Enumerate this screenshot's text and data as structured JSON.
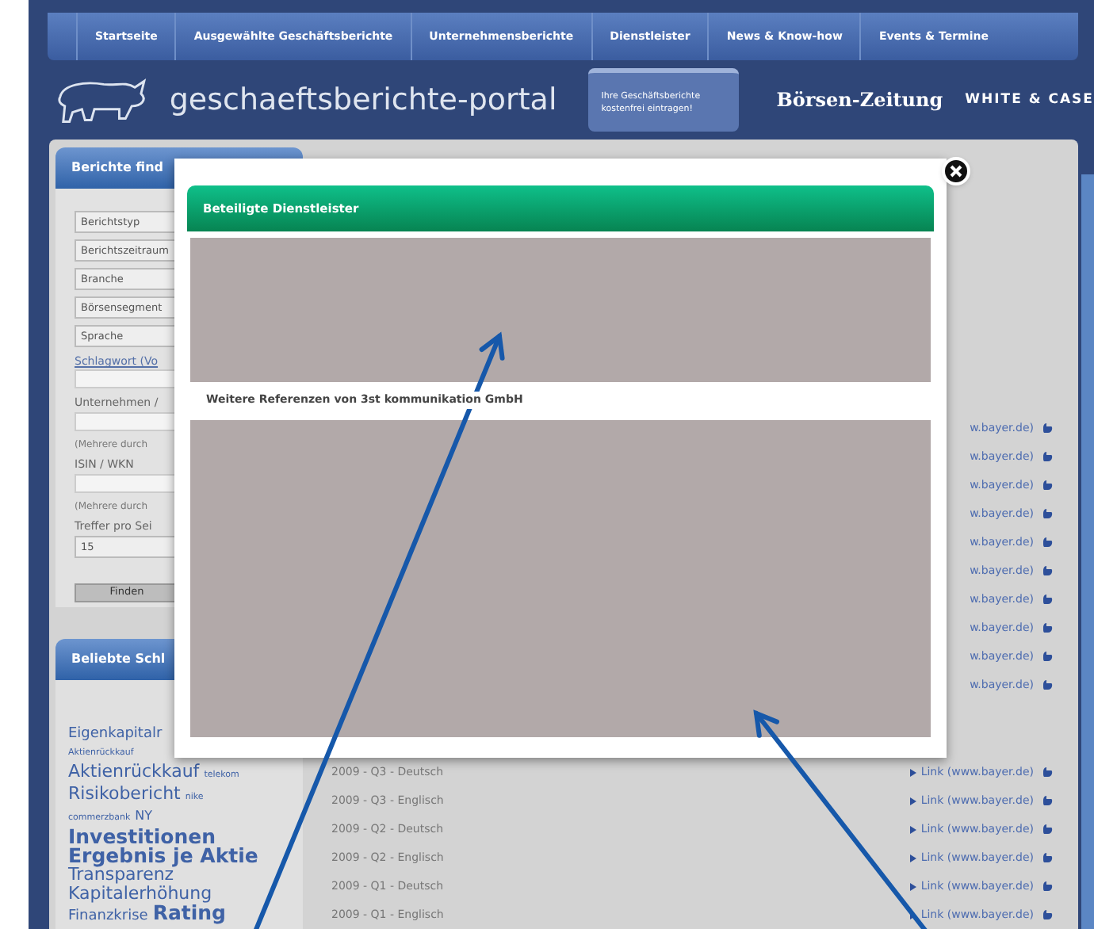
{
  "nav": {
    "tabs": [
      "Startseite",
      "Ausgewählte Geschäftsberichte",
      "Unternehmensberichte",
      "Dienstleister",
      "News & Know-how",
      "Events & Termine"
    ]
  },
  "header": {
    "logo_text": "geschaeftsberichte-portal",
    "cta_lines": [
      "Ihre Geschäftsberichte",
      "kostenfrei eintragen!"
    ],
    "partners": [
      {
        "kind": "newspaper",
        "text": "Börsen-Zeitung"
      },
      {
        "kind": "firm",
        "text": "WHITE & CASE"
      }
    ]
  },
  "search_panel": {
    "title": "Berichte find",
    "fields": [
      {
        "kind": "select",
        "text": "Berichtstyp"
      },
      {
        "kind": "select",
        "text": "Berichtszeitraum"
      },
      {
        "kind": "select",
        "text": "Branche"
      },
      {
        "kind": "select",
        "text": "Börsensegment"
      },
      {
        "kind": "select",
        "text": "Sprache"
      },
      {
        "kind": "link",
        "text": "Schlagwort (Vo"
      },
      {
        "kind": "input"
      },
      {
        "kind": "label",
        "text": "Unternehmen /"
      },
      {
        "kind": "input"
      },
      {
        "kind": "hint",
        "text": "(Mehrere durch"
      },
      {
        "kind": "label",
        "text": "ISIN / WKN"
      },
      {
        "kind": "input"
      },
      {
        "kind": "hint",
        "text": "(Mehrere durch"
      },
      {
        "kind": "label",
        "text": "Treffer pro Sei"
      },
      {
        "kind": "select",
        "text": "15"
      }
    ],
    "button": "Finden"
  },
  "tags_panel": {
    "title": "Beliebte Schl",
    "lines": [
      [
        {
          "text": "Eigenkapitalr",
          "kind": "md"
        }
      ],
      [
        {
          "text": "Aktienrückkauf",
          "kind": "xs"
        }
      ],
      [
        {
          "text": "Aktienrückkauf",
          "kind": "lg"
        },
        {
          "text": "telekom",
          "kind": "xs"
        }
      ],
      [
        {
          "text": "Risikobericht",
          "kind": "lg"
        },
        {
          "text": "nike",
          "kind": "xs"
        }
      ],
      [
        {
          "text": "commerzbank",
          "kind": "xs"
        },
        {
          "text": "NY",
          "kind": "sm"
        }
      ],
      [
        {
          "text": "Investitionen",
          "kind": "xl"
        }
      ],
      [
        {
          "text": "Ergebnis je Aktie",
          "kind": "xl"
        }
      ],
      [
        {
          "text": "Transparenz",
          "kind": "lg"
        }
      ],
      [
        {
          "text": "Kapitalerhöhung",
          "kind": "lg"
        }
      ],
      [
        {
          "text": "Finanzkrise",
          "kind": "md"
        },
        {
          "text": "Rating",
          "kind": "xl"
        }
      ]
    ]
  },
  "results": {
    "links_beside_dialog": [
      "w.bayer.de)",
      "w.bayer.de)",
      "w.bayer.de)",
      "w.bayer.de)",
      "w.bayer.de)",
      "w.bayer.de)",
      "w.bayer.de)",
      "w.bayer.de)",
      "w.bayer.de)",
      "w.bayer.de)"
    ],
    "rows": [
      {
        "label": "2009 - Q3 - Deutsch",
        "link": "Link (www.bayer.de)"
      },
      {
        "label": "2009 - Q3 - Englisch",
        "link": "Link (www.bayer.de)"
      },
      {
        "label": "2009 - Q2 - Deutsch",
        "link": "Link (www.bayer.de)"
      },
      {
        "label": "2009 - Q2 - Englisch",
        "link": "Link (www.bayer.de)"
      },
      {
        "label": "2009 - Q1 - Deutsch",
        "link": "Link (www.bayer.de)"
      },
      {
        "label": "2009 - Q1 - Englisch",
        "link": "Link (www.bayer.de)"
      }
    ]
  },
  "dialog": {
    "title": "Beteiligte Dienstleister",
    "subheading": "Weitere Referenzen von 3st kommunikation GmbH"
  }
}
